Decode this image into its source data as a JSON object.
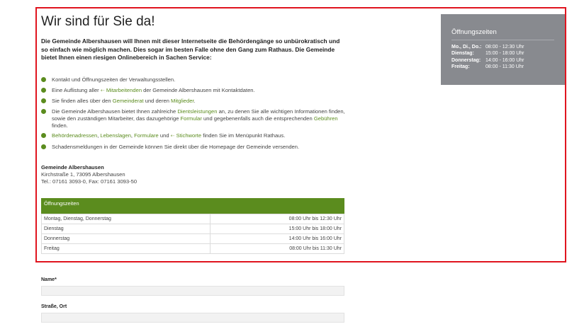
{
  "page": {
    "title": "Wir sind für Sie da!",
    "intro": "Die Gemeinde Albershausen will Ihnen mit dieser Internetseite die Behördengänge so unbürokratisch und so einfach wie möglich machen. Dies sogar im besten Falle ohne den Gang zum Rathaus. Die Gemeinde bietet Ihnen einen riesigen Onlinebereich in Sachen Service:"
  },
  "services": [
    {
      "text": "Kontakt und Öffnungszeiten der Verwaltungsstellen."
    },
    {
      "pre": "Eine Auflistung aller ",
      "arrow": "⇠",
      "link": "Mitarbeitenden",
      "post": " der Gemeinde Albershausen mit Kontaktdaten."
    },
    {
      "pre": "Sie finden alles über den ",
      "link1": "Gemeinderat",
      "mid": " und deren ",
      "link2": "Mitglieder",
      "post": "."
    },
    {
      "pre": "Die Gemeinde Albershausen bietet Ihnen zahlreiche ",
      "link1": "Dientsleistungen",
      "mid1": " an, zu denen Sie alle wichtigen Informationen finden, sowie den zuständigen Mitarbeiter, das dazugehörige ",
      "link2": "Formular",
      "mid2": " und gegebenenfalls auch die entsprechenden ",
      "link3": "Gebühren",
      "post": " finden."
    },
    {
      "link1": "Behördenadressen",
      "sep1": ", ",
      "link2": "Lebenslagen",
      "sep2": ", ",
      "link3": "Formulare",
      "mid": " und ",
      "arrow": "⇠",
      "link4": "Stichworte",
      "post": " finden Sie im Menüpunkt Rathaus."
    },
    {
      "text": "Schadensmeldungen in der Gemeinde können Sie direkt über die Homepage der Gemeinde versenden."
    }
  ],
  "address": {
    "org": "Gemeinde Albershausen",
    "street": "Kirchstraße 1, 73095 Albershausen",
    "phone": "Tel.: 07161 3093-0, Fax: 07161 3093-50"
  },
  "hours_table": {
    "header": "Öffnungszeiten",
    "rows": [
      {
        "day": "Montag, Dienstag, Donnerstag",
        "time": "08:00 Uhr bis 12:30 Uhr"
      },
      {
        "day": "Dienstag",
        "time": "15:00 Uhr bis 18:00 Uhr"
      },
      {
        "day": "Donnerstag",
        "time": "14:00 Uhr bis 16:00 Uhr"
      },
      {
        "day": "Freitag",
        "time": "08:00 Uhr bis 11:30 Uhr"
      }
    ]
  },
  "sidebar": {
    "title": "Öffnungszeiten",
    "rows": [
      {
        "day": "Mo., Di., Do.:",
        "time": "08:00 - 12:30 Uhr"
      },
      {
        "day": "Dienstag:",
        "time": "15:00 - 18:00 Uhr"
      },
      {
        "day": "Donnerstag:",
        "time": "14:00 - 16:00 Uhr"
      },
      {
        "day": "Freitag:",
        "time": "08:00 - 11:30 Uhr"
      }
    ]
  },
  "form": {
    "name_label": "Name*",
    "street_label": "Straße, Ort"
  },
  "colors": {
    "accent": "#5b8c1e",
    "highlight_border": "#e0141e",
    "sidebar_bg": "#888a8f"
  }
}
